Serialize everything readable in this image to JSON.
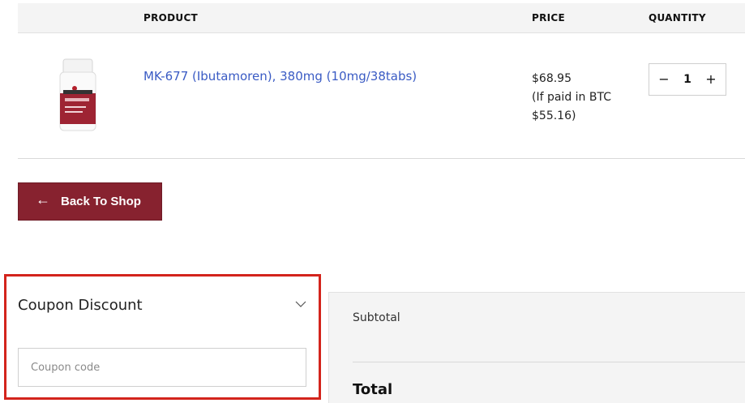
{
  "table_header": {
    "product": "PRODUCT",
    "price": "PRICE",
    "quantity": "QUANTITY"
  },
  "cart_item": {
    "image_icon": "product-bottle-image",
    "name": "MK-677 (Ibutamoren), 380mg (10mg/38tabs)",
    "price": "$68.95",
    "btc_note_line1": "(If paid in BTC",
    "btc_note_line2": "$55.16)",
    "quantity": "1",
    "minus_label": "−",
    "plus_label": "+"
  },
  "back_button": {
    "arrow": "←",
    "label": "Back To Shop"
  },
  "coupon": {
    "title": "Coupon Discount",
    "chevron_icon": "chevron-down-icon",
    "placeholder": "Coupon code",
    "highlight_color": "#d3241c"
  },
  "totals": {
    "subtotal_label": "Subtotal",
    "total_label": "Total"
  },
  "colors": {
    "accent": "#87222f",
    "link": "#3a5bc4"
  }
}
